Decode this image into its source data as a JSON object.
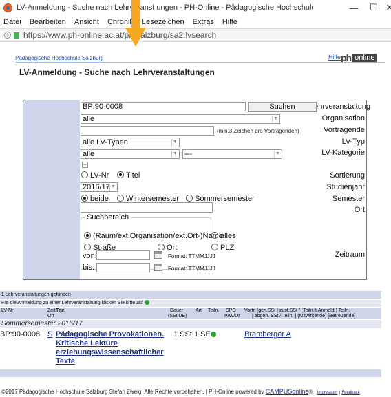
{
  "window": {
    "title": "LV-Anmeldung - Suche nach Lehrveranst   ungen - PH-Online - Pädagogische Hochschule Salzburg Stef...",
    "minimize": "—",
    "maximize": "☐",
    "close": "✕"
  },
  "menu": [
    "Datei",
    "Bearbeiten",
    "Ansicht",
    "Chronik",
    "Lesezeichen",
    "Extras",
    "Hilfe"
  ],
  "address": {
    "url": "https://www.ph-online.ac.at/ph-salzburg/sa2.lvsearch",
    "info_glyph": "i"
  },
  "header": {
    "org_link": "Pädagogische Hochschule Salzburg",
    "help_link": "Hilfe",
    "logo_ph": "ph",
    "logo_online": "online",
    "page_title": "LV-Anmeldung - Suche nach Lehrveranstaltungen"
  },
  "form": {
    "labels": {
      "lv": "Lehrveranstaltung",
      "org": "Organisation",
      "vortragende": "Vortragende",
      "lvtyp": "LV-Typ",
      "lvkat": "LV-Kategorie",
      "sort": "Sortierung",
      "studienjahr": "Studienjahr",
      "semester": "Semester",
      "ort": "Ort",
      "zeitraum": "Zeitraum"
    },
    "lv_value": "BP:90-0008",
    "search_button": "Suchen",
    "org_value": "alle",
    "vortragende_value": "",
    "vortragende_hint": "(min.3 Zeichen pro Vortragenden)",
    "lvtyp_value": "alle LV-Typen",
    "lvkat_value": "alle",
    "lvkat2_value": "---",
    "plus_glyph": "+",
    "sort_options": [
      "LV-Nr",
      "Titel"
    ],
    "studienjahr_value": "2016/17",
    "semester_options": [
      "beide",
      "Wintersemester",
      "Sommersemester"
    ],
    "ort_value": "",
    "suchbereich": {
      "legend": "Suchbereich",
      "options": [
        "(Raum/ext.Organisation/ext.Ort-)Name",
        "alles",
        "Straße",
        "Ort",
        "PLZ"
      ]
    },
    "von_label": "von:",
    "bis_label": "bis:",
    "format_hint": "Format: TTMMJJJJ"
  },
  "results": {
    "count": "1",
    "count_text": "Lehrveranstaltungen gefunden",
    "hint_text": "Für die Anmeldung zu einer Lehrveranstaltung klicken Sie bitte auf",
    "columns": {
      "lvnr": "LV-Nr",
      "zeit": "Zeit",
      "ort": "Ort",
      "titel": "Titel",
      "dauer": "Dauer",
      "dauer_unit": "(SSt|UE)",
      "art": "Art",
      "teiln": "Teiln.",
      "spo": "SPO",
      "spo2": "P/W/Dr",
      "vortr1": "Vortr. [gen.SSt | zust.SSt / (Teiln.lt.Anmeld.) Teiln.",
      "vortr2": "| abgeh. SSt / Teiln. ] (Mitwirkende) [Betreuende]"
    },
    "semester": "Sommersemester 2016/17",
    "row": {
      "lvnr": "BP:90-0008",
      "s": "S",
      "title_lines": [
        "Pädagogische Provokationen.",
        "Kritische Lektüre",
        "erziehungswissenschaftlicher",
        "Texte"
      ],
      "dauer": "1 SSt",
      "art": "1 SE",
      "vortr": "Bramberger A"
    }
  },
  "footer": {
    "text": "©2017 Pädagogische Hochschule Salzburg Stefan Zweig. Alle Rechte vorbehalten. | PH-Online powered by",
    "campus": "CAMPUSonline",
    "reg": "® |",
    "impressum": "Impressum",
    "sep": "|",
    "feedback": "Feedback"
  },
  "colors": {
    "label_bg": "#cfd5ea",
    "link": "#1e2f8a",
    "arrow": "#f5a623"
  }
}
